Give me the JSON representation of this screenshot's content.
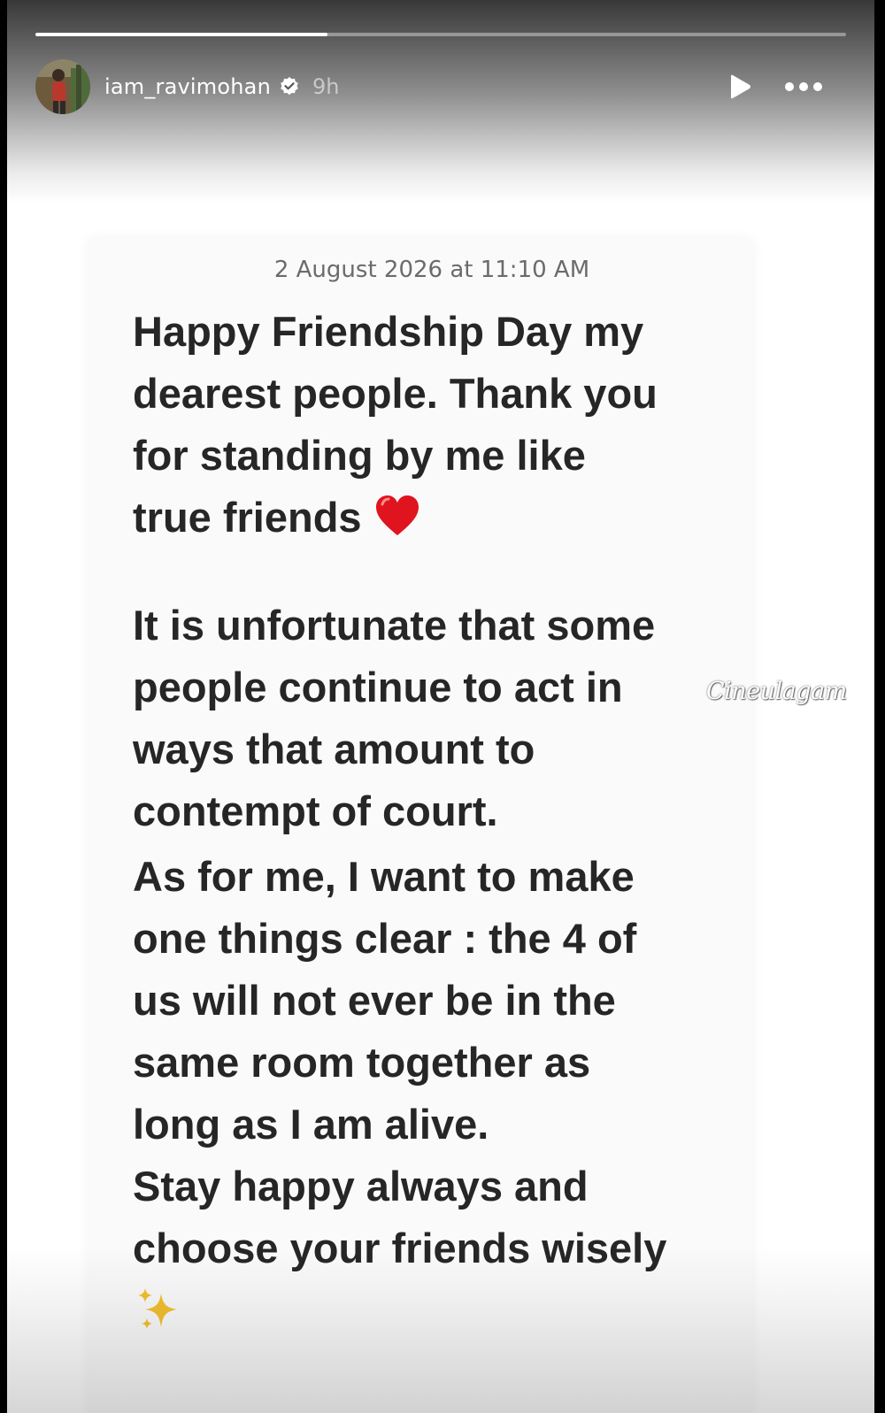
{
  "story": {
    "progress": 0.36,
    "header": {
      "username": "iam_ravimohan",
      "verified": true,
      "time": "9h",
      "avatar_icon": "profile-avatar-icon",
      "play_icon": "play-icon",
      "more_icon": "more-options-icon"
    },
    "note": {
      "date": "2 August 2026 at 11:10 AM",
      "paragraph1_lines": [
        "Happy Friendship Day my",
        "dearest people. Thank you",
        "for standing by me like",
        "true friends"
      ],
      "paragraph1_emoji": "red-heart-icon",
      "paragraph2_lines": [
        "It is unfortunate that some",
        "people continue to act in",
        "ways that amount to",
        "contempt of court."
      ],
      "paragraph3_lines": [
        "As for me, I want to make",
        "one things clear : the 4 of",
        "us will not ever be in the",
        "same room together as",
        "long as I am alive."
      ],
      "paragraph4_lines": [
        "Stay happy always and",
        "choose your friends wisely"
      ],
      "closing_emoji": "sparkles-icon"
    },
    "watermark": "Cineulagam"
  },
  "colors": {
    "text": "#262626",
    "date": "#6b6b6b",
    "heart": "#e0141e",
    "sparkles": "#f2c12e"
  }
}
